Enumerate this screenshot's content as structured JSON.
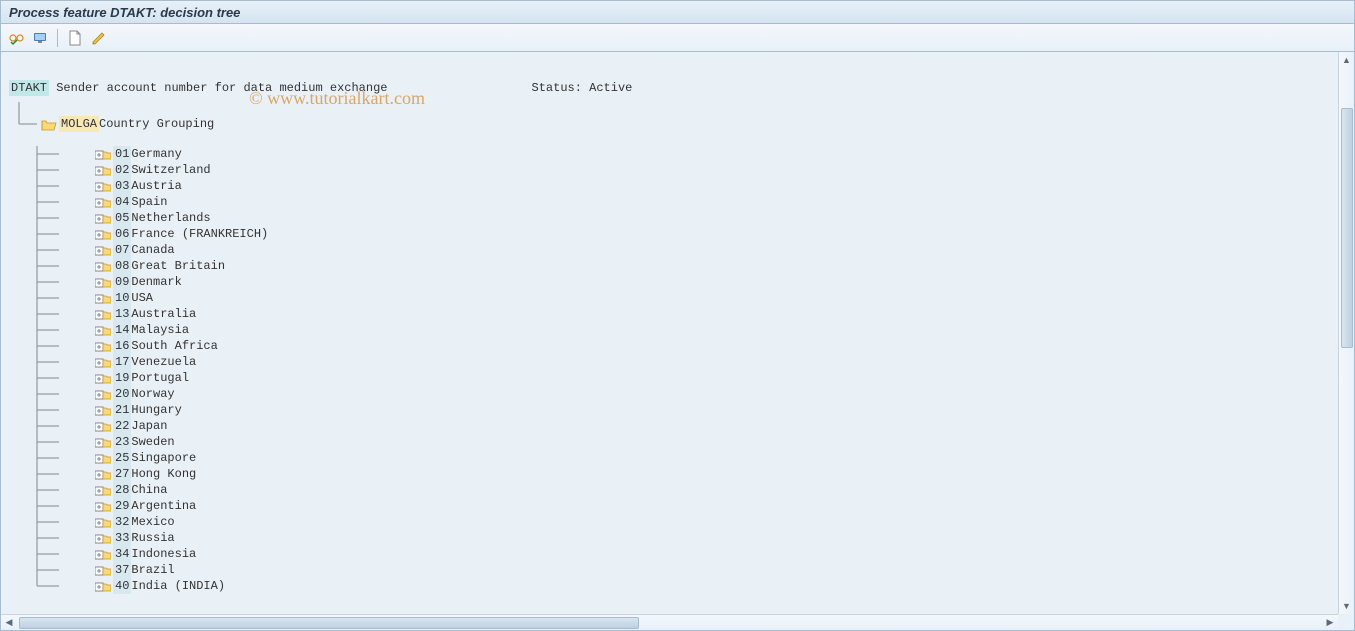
{
  "title": "Process feature DTAKT: decision tree",
  "watermark": "© www.tutorialkart.com",
  "root": {
    "id": "DTAKT",
    "description": "Sender account number for data medium exchange",
    "status_label": "Status:",
    "status_value": "Active"
  },
  "grouping": {
    "id": "MOLGA",
    "description": "Country Grouping"
  },
  "items": [
    {
      "code": "01",
      "label": "Germany"
    },
    {
      "code": "02",
      "label": "Switzerland"
    },
    {
      "code": "03",
      "label": "Austria"
    },
    {
      "code": "04",
      "label": "Spain"
    },
    {
      "code": "05",
      "label": "Netherlands"
    },
    {
      "code": "06",
      "label": "France (FRANKREICH)"
    },
    {
      "code": "07",
      "label": "Canada"
    },
    {
      "code": "08",
      "label": "Great Britain"
    },
    {
      "code": "09",
      "label": "Denmark"
    },
    {
      "code": "10",
      "label": "USA"
    },
    {
      "code": "13",
      "label": "Australia"
    },
    {
      "code": "14",
      "label": "Malaysia"
    },
    {
      "code": "16",
      "label": "South Africa"
    },
    {
      "code": "17",
      "label": "Venezuela"
    },
    {
      "code": "19",
      "label": "Portugal"
    },
    {
      "code": "20",
      "label": "Norway"
    },
    {
      "code": "21",
      "label": "Hungary"
    },
    {
      "code": "22",
      "label": "Japan"
    },
    {
      "code": "23",
      "label": "Sweden"
    },
    {
      "code": "25",
      "label": "Singapore"
    },
    {
      "code": "27",
      "label": "Hong Kong"
    },
    {
      "code": "28",
      "label": "China"
    },
    {
      "code": "29",
      "label": "Argentina"
    },
    {
      "code": "32",
      "label": "Mexico"
    },
    {
      "code": "33",
      "label": "Russia"
    },
    {
      "code": "34",
      "label": "Indonesia"
    },
    {
      "code": "37",
      "label": "Brazil"
    },
    {
      "code": "40",
      "label": "India (INDIA)"
    }
  ]
}
